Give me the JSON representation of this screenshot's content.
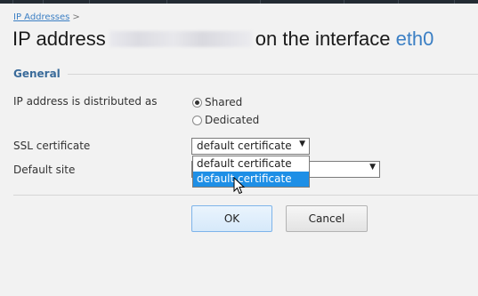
{
  "breadcrumb": {
    "link": "IP Addresses",
    "separator": ">"
  },
  "title": {
    "prefix": "IP address",
    "middle": "on the interface",
    "interface": "eth0"
  },
  "section": {
    "legend": "General"
  },
  "distribution": {
    "label": "IP address is distributed as",
    "options": [
      {
        "label": "Shared",
        "checked": true
      },
      {
        "label": "Dedicated",
        "checked": false
      }
    ]
  },
  "ssl": {
    "label": "SSL certificate",
    "selected": "default certificate",
    "dropdown_options": [
      "default certificate",
      "default certificate"
    ],
    "highlighted_index": 1
  },
  "default_site": {
    "label": "Default site",
    "value": ""
  },
  "buttons": {
    "ok": "OK",
    "cancel": "Cancel"
  },
  "colors": {
    "link": "#3b7fc4",
    "highlight": "#1e8fe6",
    "legend": "#3a6b9a"
  },
  "cursor": {
    "icon": "arrow-pointer-icon"
  }
}
